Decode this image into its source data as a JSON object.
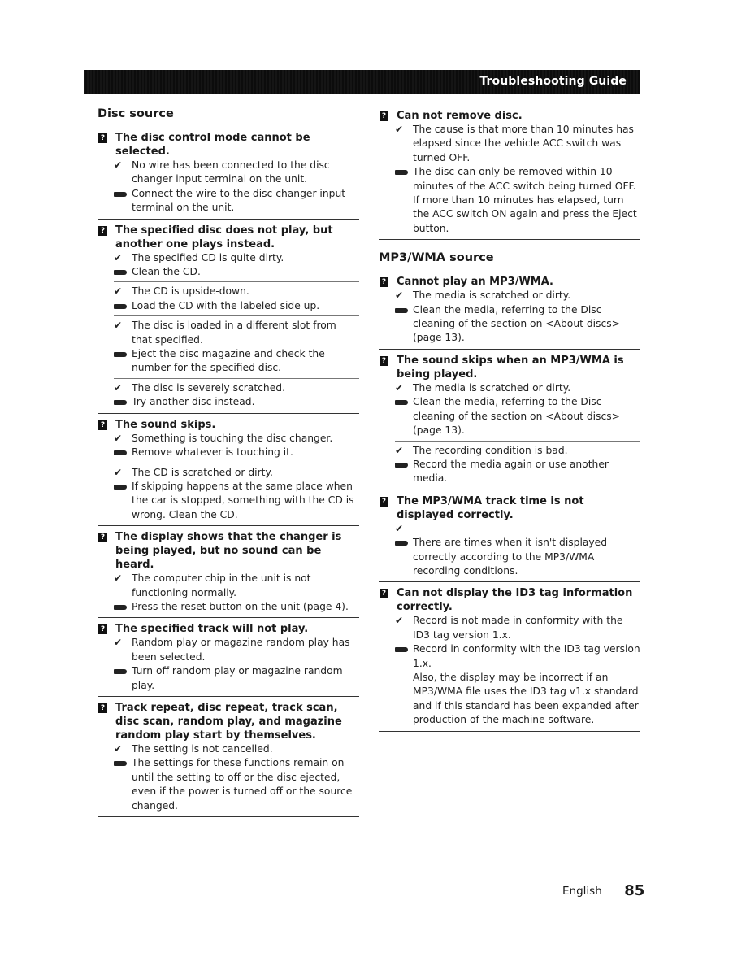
{
  "header": {
    "title": "Troubleshooting Guide"
  },
  "left": {
    "section_title": "Disc source",
    "problems": [
      {
        "question": "The disc control mode cannot be selected.",
        "groups": [
          {
            "cause": "No wire has been connected to the disc changer input terminal on the unit.",
            "fix": "Connect the wire to the disc changer input terminal on the unit."
          }
        ]
      },
      {
        "question": "The specified disc does not play, but another one plays instead.",
        "groups": [
          {
            "cause": "The specified CD is quite dirty.",
            "fix": "Clean the CD."
          },
          {
            "cause": "The CD is upside-down.",
            "fix": "Load the CD with the labeled side up."
          },
          {
            "cause": "The disc is loaded in a different slot from that specified.",
            "fix": "Eject the disc magazine and check the number for the specified disc."
          },
          {
            "cause": "The disc is severely scratched.",
            "fix": "Try another disc instead."
          }
        ]
      },
      {
        "question": "The sound skips.",
        "groups": [
          {
            "cause": "Something is touching the disc changer.",
            "fix": "Remove whatever is touching it."
          },
          {
            "cause": "The CD is scratched or dirty.",
            "fix": "If skipping happens at the same place when the car is stopped, something with the CD is wrong. Clean the CD."
          }
        ]
      },
      {
        "question": "The display shows that the changer is being played, but no sound can be heard.",
        "groups": [
          {
            "cause": "The computer chip in the unit is not functioning normally.",
            "fix": "Press the reset button on the unit (page 4)."
          }
        ]
      },
      {
        "question": "The specified track will not play.",
        "groups": [
          {
            "cause": "Random play or magazine random play has been selected.",
            "fix": "Turn off random play or magazine random play."
          }
        ]
      },
      {
        "question": "Track repeat, disc repeat, track scan, disc scan, random play, and magazine random play start by themselves.",
        "groups": [
          {
            "cause": "The setting is not cancelled.",
            "fix": "The settings for these functions remain on until the setting to off or the disc ejected, even if the power is turned off or the source changed."
          }
        ]
      }
    ]
  },
  "right": {
    "top_problem": {
      "question": "Can not remove disc.",
      "cause": "The cause is that more than 10 minutes has elapsed since the vehicle ACC switch was turned OFF.",
      "fix": "The disc can only be removed within 10 minutes of the ACC switch being turned OFF. If more than 10 minutes has elapsed, turn the ACC switch ON again and press the Eject button."
    },
    "section_title": "MP3/WMA source",
    "problems": [
      {
        "question": "Cannot play an MP3/WMA.",
        "groups": [
          {
            "cause": "The media is scratched or dirty.",
            "fix": "Clean the media, referring to the Disc cleaning of the section on <About discs> (page 13)."
          }
        ]
      },
      {
        "question": "The sound skips when an MP3/WMA is being played.",
        "groups": [
          {
            "cause": "The media is scratched or dirty.",
            "fix": "Clean the media, referring to the Disc cleaning of the section on <About discs> (page 13)."
          },
          {
            "cause": "The recording condition is bad.",
            "fix": "Record the media again or use another media."
          }
        ]
      },
      {
        "question": "The MP3/WMA track time is not displayed correctly.",
        "groups": [
          {
            "cause": "---",
            "fix": "There are times when it isn't displayed correctly according to the MP3/WMA recording conditions."
          }
        ]
      },
      {
        "question": "Can not display the ID3 tag information correctly.",
        "groups": [
          {
            "cause": "Record is not made in conformity with the ID3 tag version 1.x.",
            "fix": "Record in conformity with the ID3 tag version 1.x.",
            "note": "Also, the display may be incorrect if an MP3/WMA file uses the ID3 tag v1.x standard and if this standard has been expanded after production of the machine software."
          }
        ]
      }
    ]
  },
  "icons": {
    "question": "?",
    "cause": "✔"
  },
  "footer": {
    "language": "English",
    "page_number": "85"
  }
}
